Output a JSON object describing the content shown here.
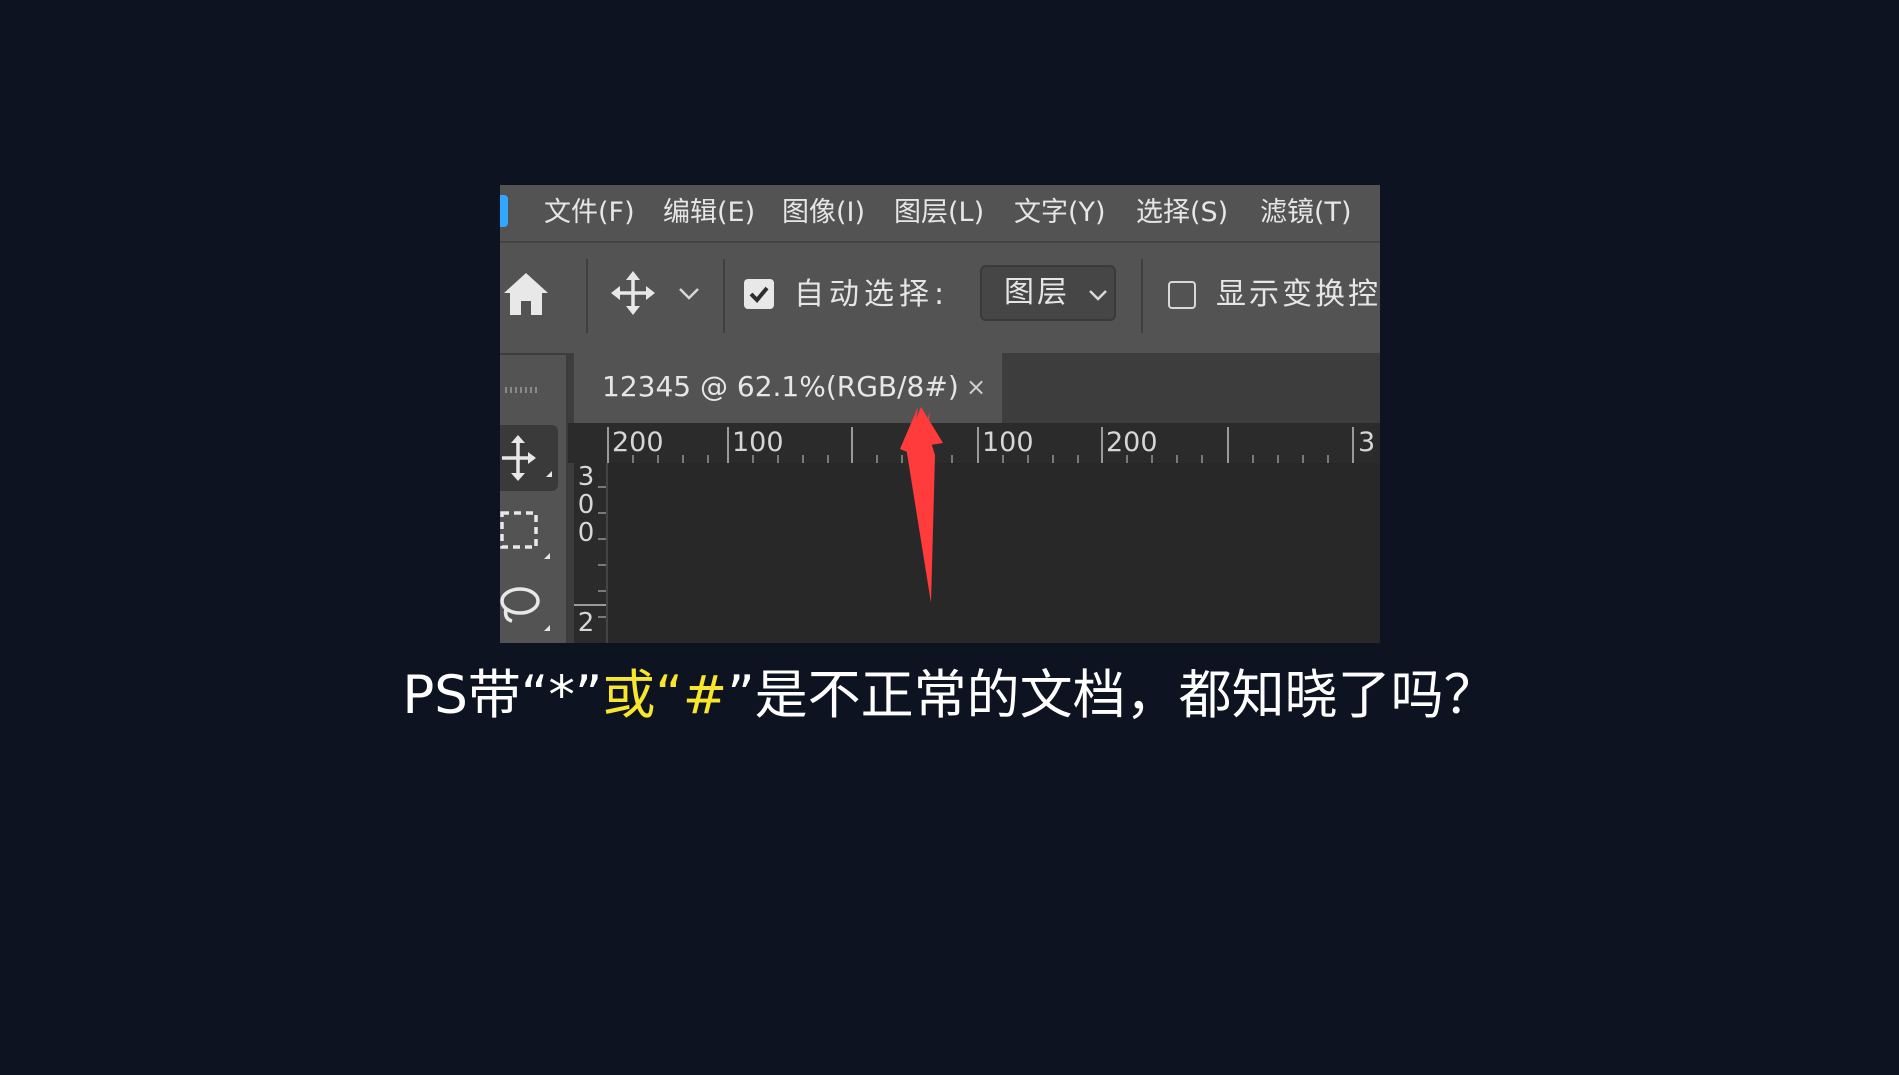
{
  "colors": {
    "page_background": "#0e1322",
    "ps_panel": "#535353",
    "canvas": "#282828",
    "ruler": "#2b2b2b",
    "arrow": "#ff3b3b",
    "caption_text": "#ffffff",
    "caption_highlight": "#f7e62b"
  },
  "menu": {
    "items": [
      "文件(F)",
      "编辑(E)",
      "图像(I)",
      "图层(L)",
      "文字(Y)",
      "选择(S)",
      "滤镜(T)"
    ]
  },
  "options_bar": {
    "home_icon": "home-icon",
    "move_icon": "move-tool-icon",
    "auto_select_checked": true,
    "auto_select_label": "自动选择:",
    "auto_select_value": "图层",
    "show_transform_checked": false,
    "show_transform_label": "显示变换控"
  },
  "toolbar": {
    "tools": [
      "move-tool-icon",
      "rectangular-marquee-icon",
      "lasso-icon"
    ]
  },
  "document": {
    "tab_title": "12345 @ 62.1%(RGB/8#)",
    "close_glyph": "×",
    "ruler_h_labels": [
      "200",
      "100",
      "100",
      "200",
      "3"
    ],
    "ruler_v_labels": [
      "3",
      "0",
      "0",
      "2"
    ]
  },
  "caption": {
    "part1": "PS带“*”",
    "part2": "或",
    "part3": "“#",
    "part4": "”是不正常的文档，都知晓了吗？"
  }
}
